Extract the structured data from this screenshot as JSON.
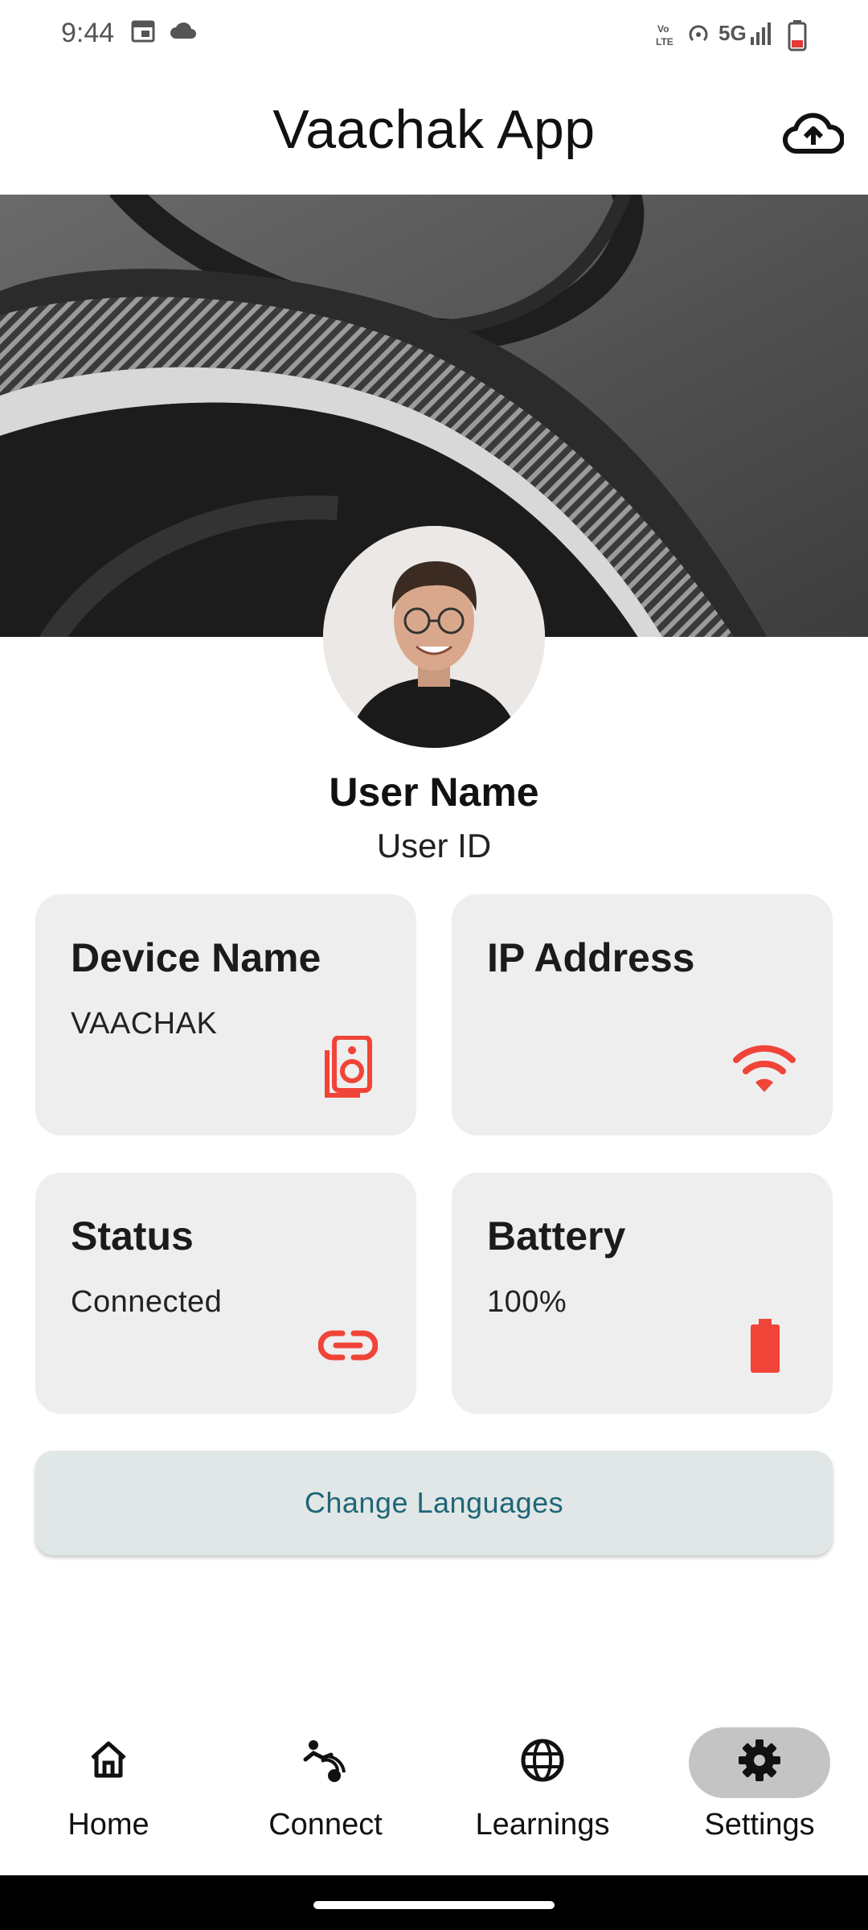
{
  "status_bar": {
    "time": "9:44",
    "left_icons": [
      "calendar-icon",
      "cloud-icon"
    ],
    "network_label": "5G",
    "right_icons": [
      "volte-icon",
      "hotspot-icon",
      "signal-icon",
      "battery-icon"
    ]
  },
  "app_bar": {
    "title": "Vaachak App",
    "action_icon": "cloud-upload-icon"
  },
  "profile": {
    "name": "User Name",
    "id": "User ID"
  },
  "cards": [
    {
      "title": "Device Name",
      "value": "VAACHAK",
      "icon": "speaker-icon"
    },
    {
      "title": "IP Address",
      "value": "",
      "icon": "wifi-icon"
    },
    {
      "title": "Status",
      "value": "Connected",
      "icon": "link-icon"
    },
    {
      "title": "Battery",
      "value": "100%",
      "icon": "battery-full-icon"
    }
  ],
  "change_languages_label": "Change Languages",
  "bottom_nav": {
    "items": [
      {
        "label": "Home",
        "icon": "home-icon"
      },
      {
        "label": "Connect",
        "icon": "connect-icon"
      },
      {
        "label": "Learnings",
        "icon": "globe-icon"
      },
      {
        "label": "Settings",
        "icon": "gear-icon"
      }
    ],
    "selected": "Settings"
  },
  "colors": {
    "accent_red": "#f04438",
    "button_text": "#1f6677",
    "button_bg": "#e1e7e7",
    "card_bg": "#eeeeee",
    "nav_selected_bg": "#c4c4c4"
  }
}
